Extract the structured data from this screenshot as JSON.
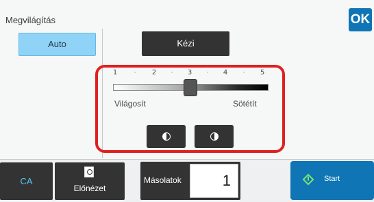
{
  "header": {
    "title": "Megvilágítás",
    "ok_label": "OK"
  },
  "mode": {
    "auto_label": "Auto",
    "manual_label": "Kézi",
    "selected": "Auto"
  },
  "exposure": {
    "scale_labels": [
      "1",
      "2",
      "3",
      "4",
      "5"
    ],
    "scale_separator": "·",
    "value": 3,
    "min": 1,
    "max": 5,
    "light_label": "Világosít",
    "dark_label": "Sötétít",
    "decrease_icon": "half-light-circle-icon",
    "increase_icon": "half-dark-circle-icon"
  },
  "footer": {
    "ca_label": "CA",
    "preview_label": "Előnézet",
    "preview_icon": "preview-magnifier-icon",
    "copies_label": "Másolatok",
    "copies_value": "1",
    "start_label": "Start",
    "start_icon": "start-diamond-icon"
  },
  "colors": {
    "accent": "#0f75b5",
    "auto_selected": "#8fd3f7",
    "highlight": "#e02020",
    "ca_text": "#58c4f3",
    "start_icon": "#7ee36d"
  }
}
